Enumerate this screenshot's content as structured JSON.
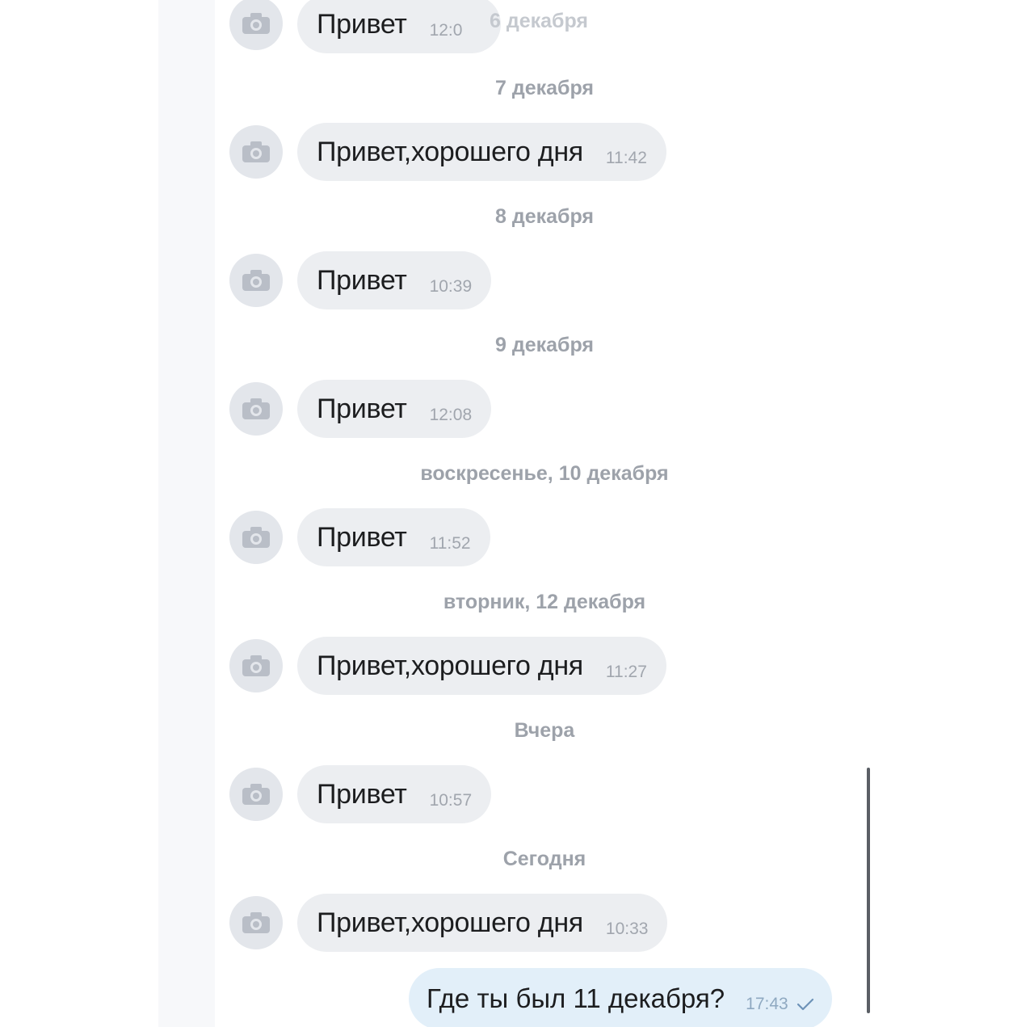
{
  "messages": [
    {
      "text": "Привет",
      "time": "12:0"
    },
    {
      "text": "Привет,хорошего дня",
      "time": "11:42"
    },
    {
      "text": "Привет",
      "time": "10:39"
    },
    {
      "text": "Привет",
      "time": "12:08"
    },
    {
      "text": "Привет",
      "time": "11:52"
    },
    {
      "text": "Привет,хорошего дня",
      "time": "11:27"
    },
    {
      "text": "Привет",
      "time": "10:57"
    },
    {
      "text": "Привет,хорошего дня",
      "time": "10:33"
    }
  ],
  "dates": [
    "6 декабря",
    "7 декабря",
    "8 декабря",
    "9 декабря",
    "воскресенье, 10 декабря",
    "вторник, 12 декабря",
    "Вчера",
    "Сегодня"
  ],
  "outgoing": {
    "text": "Где ты был 11 декабря?",
    "time": "17:43",
    "status_icon": "check-icon"
  },
  "avatar_icon": "camera-icon",
  "colors": {
    "incoming_bubble": "#eceef1",
    "outgoing_bubble": "#e2eff9",
    "avatar_bg": "#e3e6eb",
    "date_text": "#9da2aa"
  }
}
